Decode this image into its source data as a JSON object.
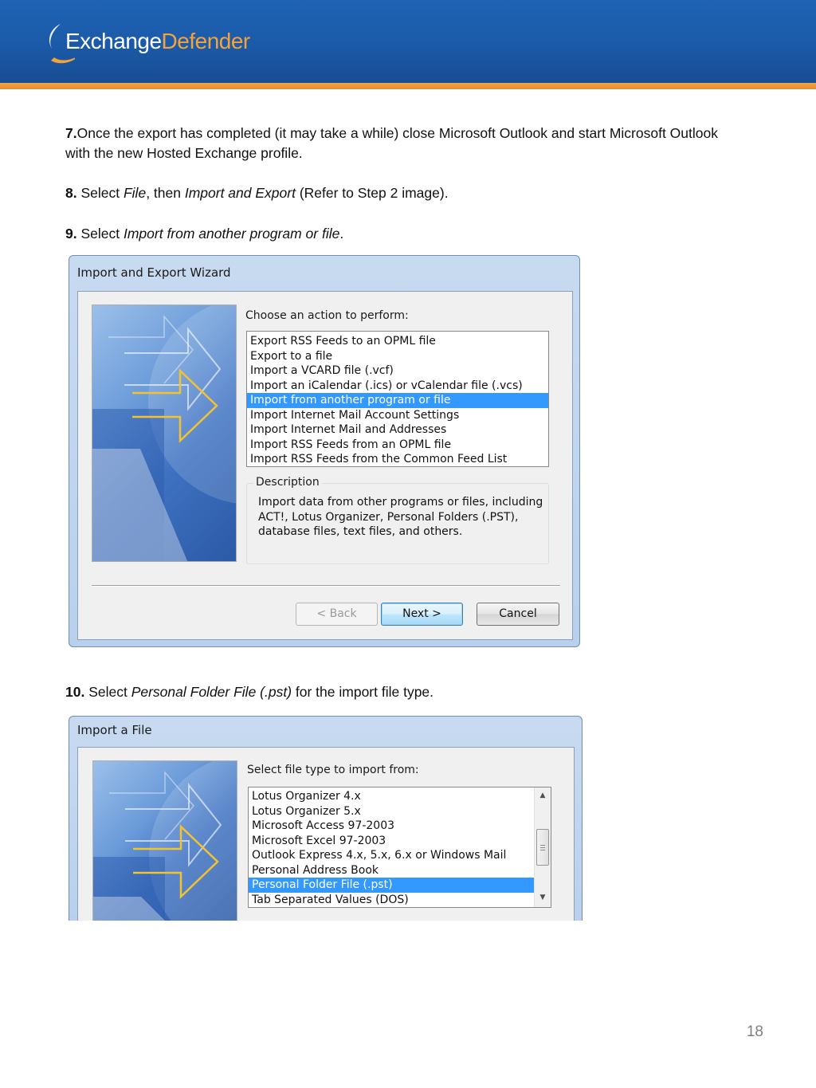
{
  "header": {
    "logo_text_a": "Exchange",
    "logo_text_b": "Defender",
    "colors": {
      "banner": "#1b5aa8",
      "stripe": "#e88b2a",
      "accent": "#f5a23c"
    }
  },
  "steps": {
    "s7": {
      "num": "7.",
      "text": "Once the export has completed (it may take a while) close Microsoft Outlook and start Microsoft Outlook with the new Hosted Exchange profile."
    },
    "s8": {
      "num": "8.",
      "pre": " Select ",
      "file": "File",
      "mid": ", then ",
      "ie": "Import and Export",
      "post": " (Refer to Step 2 image)."
    },
    "s9": {
      "num": "9.",
      "pre": " Select ",
      "ital": "Import from another program or file",
      "post": "."
    },
    "s10": {
      "num": "10.",
      "pre": " Select ",
      "ital": "Personal Folder File (.pst)",
      "post": " for the import file type."
    }
  },
  "wizard": {
    "title": "Import and Export Wizard",
    "prompt": "Choose an action to perform:",
    "items": [
      "Export RSS Feeds to an OPML file",
      "Export to a file",
      "Import a VCARD file (.vcf)",
      "Import an iCalendar (.ics) or vCalendar file (.vcs)",
      "Import from another program or file",
      "Import Internet Mail Account Settings",
      "Import Internet Mail and Addresses",
      "Import RSS Feeds from an OPML file",
      "Import RSS Feeds from the Common Feed List"
    ],
    "selected_index": 4,
    "description_label": "Description",
    "description_text": "Import data from other programs or files, including ACT!, Lotus Organizer, Personal Folders (.PST), database files, text files, and others.",
    "back_label": "< Back",
    "next_label": "Next >",
    "cancel_label": "Cancel"
  },
  "import_file": {
    "title": "Import a File",
    "prompt": "Select file type to import from:",
    "items": [
      "Lotus Organizer 4.x",
      "Lotus Organizer 5.x",
      "Microsoft Access 97-2003",
      "Microsoft Excel 97-2003",
      "Outlook Express 4.x, 5.x, 6.x or Windows Mail",
      "Personal Address Book",
      "Personal Folder File (.pst)",
      "Tab Separated Values (DOS)"
    ],
    "selected_index": 6
  },
  "footer": {
    "page_number": "18"
  }
}
